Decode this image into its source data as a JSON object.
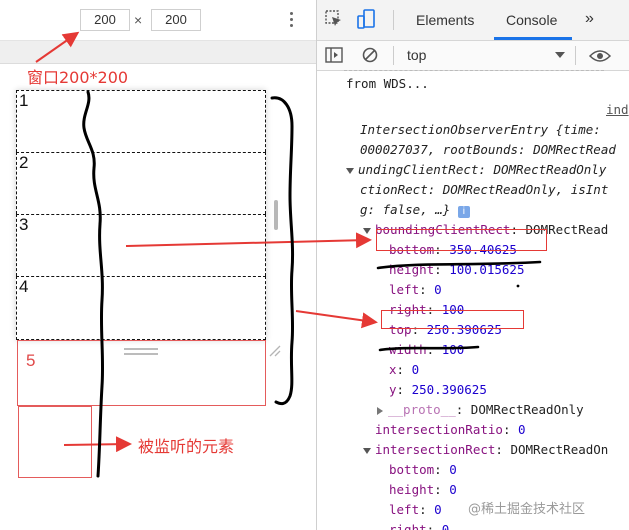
{
  "device_toolbar": {
    "width_value": "200",
    "height_value": "200",
    "times_sign": "×"
  },
  "boxes": [
    "1",
    "2",
    "3",
    "4"
  ],
  "box5_label": "5",
  "annotations": {
    "window_size": "窗口200*200",
    "observed_element": "被监听的元素"
  },
  "devtools": {
    "tabs": {
      "elements": "Elements",
      "console": "Console",
      "more": "»"
    },
    "context": "top",
    "lines": {
      "wds_tail": "from WDS...",
      "source_link": "ind",
      "entry_head": "IntersectionObserverEntry {time:",
      "entry_time": "000027037, rootBounds: DOMRectRead",
      "bounding_cut": "undingClientRect: DOMRectReadOnly",
      "intersection_cut": "ctionRect: DOMRectReadOnly, isInt",
      "preview_tail": "g: false, …}",
      "bounding_key": "boundingClientRect",
      "bounding_type": "DOMRectRead",
      "bottom_key": "bottom",
      "bottom_val": "350.40625",
      "height_key": "height",
      "height_val": "100.015625",
      "left_key": "left",
      "left_val": "0",
      "right_key": "right",
      "right_val": "100",
      "top_key": "top",
      "top_val": "250.390625",
      "width_key": "width",
      "width_val": "100",
      "x_key": "x",
      "x_val": "0",
      "y_key": "y",
      "y_val": "250.390625",
      "proto_key": "__proto__",
      "proto_val": "DOMRectReadOnly",
      "ratio_key": "intersectionRatio",
      "ratio_val": "0",
      "irect_key": "intersectionRect",
      "irect_type": "DOMRectReadOn",
      "ib_key": "bottom",
      "ib_val": "0",
      "ih_key": "height",
      "ih_val": "0",
      "il_key": "left",
      "il_val": "0",
      "ir_key": "right",
      "ir_val": "0"
    }
  },
  "watermark": "@稀土掘金技术社区",
  "colors": {
    "annotation_red": "#e53935",
    "console_accent": "#1a73e8",
    "property_key": "#881280",
    "number": "#1c00cf"
  },
  "icons": [
    "more-vert-icon",
    "inspect-element-icon",
    "device-toggle-icon",
    "sidebar-toggle-icon",
    "clear-console-icon",
    "eye-icon",
    "info-icon",
    "chevron-down-icon"
  ]
}
